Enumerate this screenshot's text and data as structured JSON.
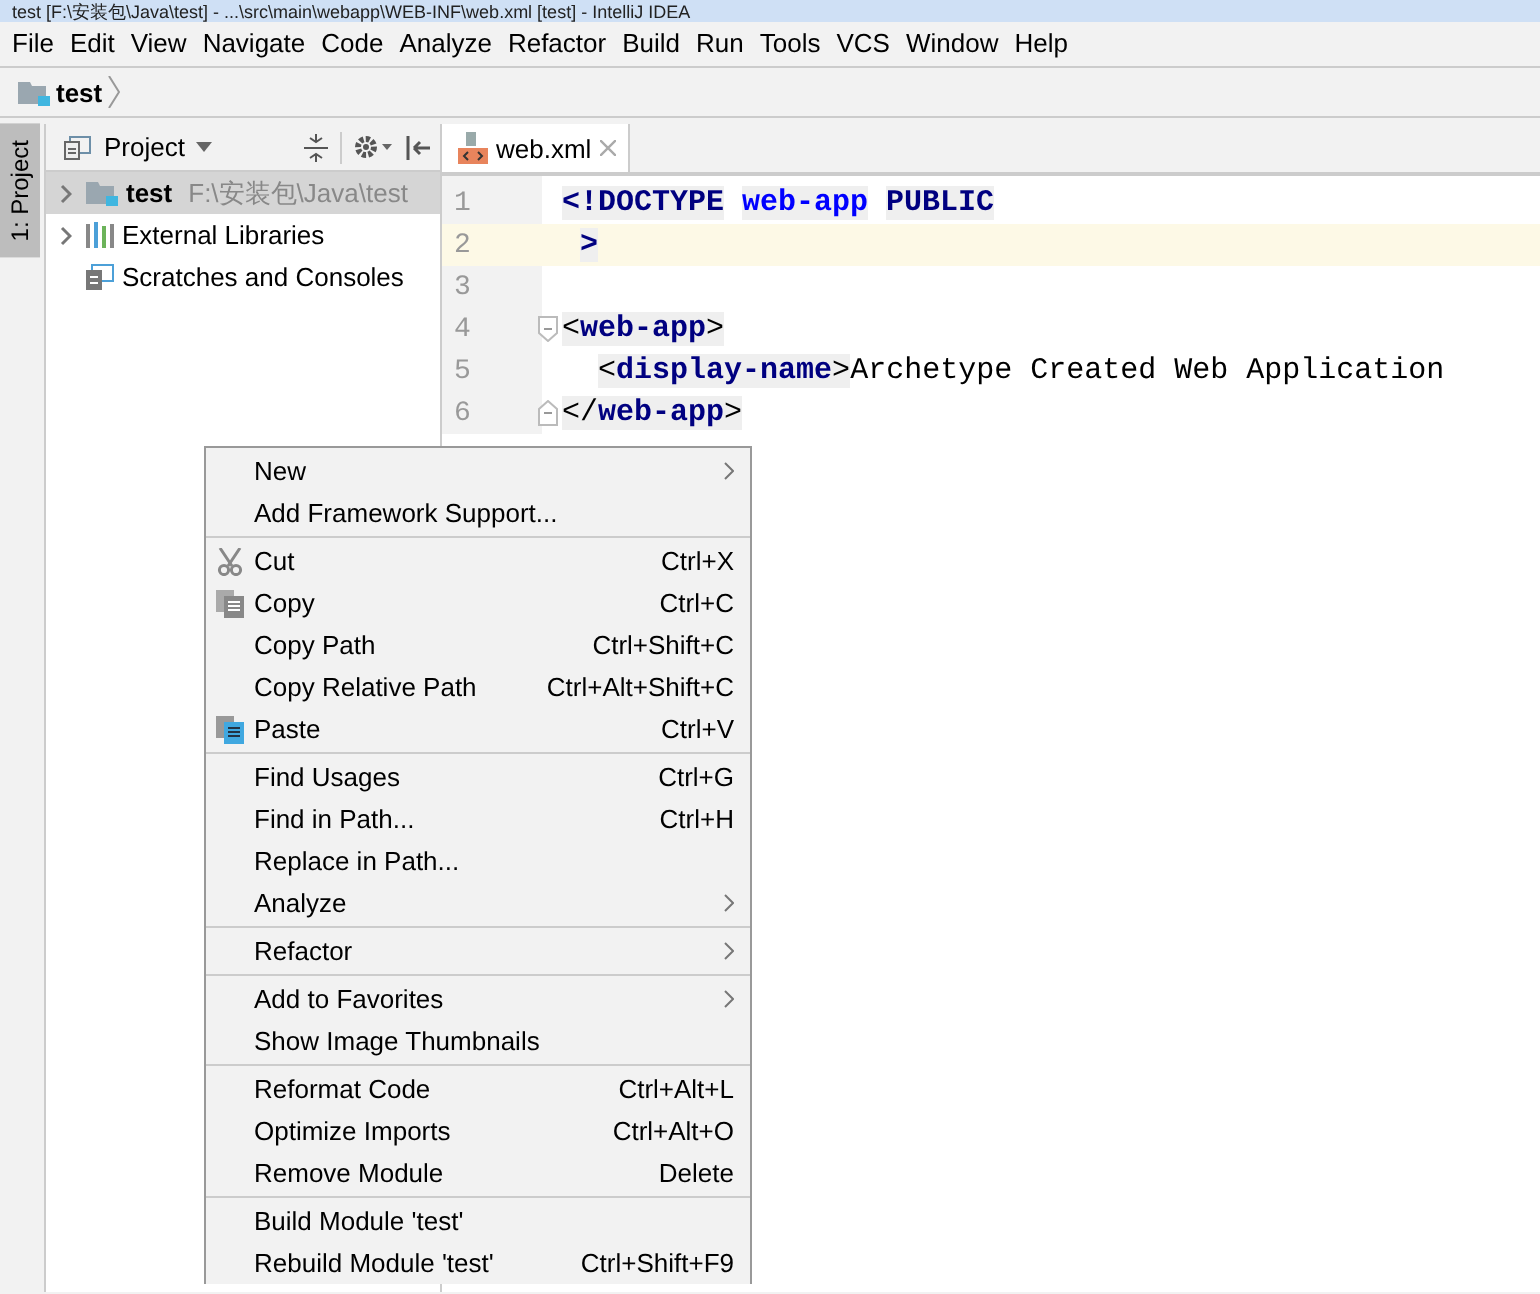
{
  "window": {
    "title": "test [F:\\安装包\\Java\\test] - ...\\src\\main\\webapp\\WEB-INF\\web.xml [test] - IntelliJ IDEA"
  },
  "menu_bar": [
    "File",
    "Edit",
    "View",
    "Navigate",
    "Code",
    "Analyze",
    "Refactor",
    "Build",
    "Run",
    "Tools",
    "VCS",
    "Window",
    "Help"
  ],
  "breadcrumb": {
    "label": "test"
  },
  "tool_stripe": {
    "label": "1: Project",
    "selected": true
  },
  "project_panel": {
    "title": "Project",
    "tree": [
      {
        "label": "test",
        "path": "F:\\安装包\\Java\\test",
        "kind": "module",
        "expanded": false,
        "selected": true
      },
      {
        "label": "External Libraries",
        "kind": "libraries",
        "expanded": false,
        "selected": false
      },
      {
        "label": "Scratches and Consoles",
        "kind": "scratches",
        "selected": false
      }
    ]
  },
  "editor": {
    "tabs": [
      {
        "label": "web.xml",
        "selected": true
      }
    ],
    "lines": [
      {
        "number": "1",
        "current": false,
        "kind": "plain",
        "tokens": [
          {
            "kind": "keyword",
            "text": "<!DOCTYPE"
          },
          {
            "kind": "name",
            "text": "web-app",
            "spaced": true
          },
          {
            "kind": "keyword",
            "text": "PUBLIC",
            "spaced": true
          }
        ]
      },
      {
        "number": "2",
        "current": true,
        "kind": "plain",
        "tokens": [
          {
            "kind": "keyword",
            "text": ">",
            "spaced": true
          }
        ]
      },
      {
        "number": "3",
        "current": false,
        "kind": "plain"
      },
      {
        "number": "4",
        "current": false,
        "kind": "fold_start",
        "tokens": [
          {
            "kind": "punct",
            "text": "<"
          },
          {
            "kind": "tag",
            "text": "web-app"
          },
          {
            "kind": "punct",
            "text": ">"
          }
        ]
      },
      {
        "number": "5",
        "current": false,
        "kind": "indented",
        "tokens": [
          {
            "kind": "punct",
            "text": "<"
          },
          {
            "kind": "tag",
            "text": "display-name"
          },
          {
            "kind": "punct",
            "text": ">"
          },
          {
            "kind": "text",
            "text": "Archetype Created Web Application"
          }
        ]
      },
      {
        "number": "6",
        "current": false,
        "kind": "fold_end",
        "tokens": [
          {
            "kind": "punct",
            "text": "</"
          },
          {
            "kind": "tag",
            "text": "web-app"
          },
          {
            "kind": "punct",
            "text": ">"
          }
        ]
      }
    ]
  },
  "context_menu": [
    [
      {
        "label": "New",
        "submenu": true,
        "kind": "plain"
      },
      {
        "label": "Add Framework Support...",
        "kind": "plain"
      }
    ],
    [
      {
        "label": "Cut",
        "shortcut": "Ctrl+X",
        "kind": "cut"
      },
      {
        "label": "Copy",
        "shortcut": "Ctrl+C",
        "kind": "copy"
      },
      {
        "label": "Copy Path",
        "shortcut": "Ctrl+Shift+C",
        "kind": "plain"
      },
      {
        "label": "Copy Relative Path",
        "shortcut": "Ctrl+Alt+Shift+C",
        "kind": "plain"
      },
      {
        "label": "Paste",
        "shortcut": "Ctrl+V",
        "kind": "paste"
      }
    ],
    [
      {
        "label": "Find Usages",
        "shortcut": "Ctrl+G",
        "kind": "plain"
      },
      {
        "label": "Find in Path...",
        "shortcut": "Ctrl+H",
        "kind": "plain"
      },
      {
        "label": "Replace in Path...",
        "kind": "plain"
      },
      {
        "label": "Analyze",
        "submenu": true,
        "kind": "plain"
      }
    ],
    [
      {
        "label": "Refactor",
        "submenu": true,
        "kind": "plain"
      }
    ],
    [
      {
        "label": "Add to Favorites",
        "submenu": true,
        "kind": "plain"
      },
      {
        "label": "Show Image Thumbnails",
        "kind": "plain"
      }
    ],
    [
      {
        "label": "Reformat Code",
        "shortcut": "Ctrl+Alt+L",
        "kind": "plain"
      },
      {
        "label": "Optimize Imports",
        "shortcut": "Ctrl+Alt+O",
        "kind": "plain"
      },
      {
        "label": "Remove Module",
        "shortcut": "Delete",
        "kind": "plain"
      }
    ],
    [
      {
        "label": "Build Module 'test'",
        "kind": "plain"
      },
      {
        "label": "Rebuild Module 'test'",
        "shortcut": "Ctrl+Shift+F9",
        "kind": "plain"
      }
    ]
  ]
}
